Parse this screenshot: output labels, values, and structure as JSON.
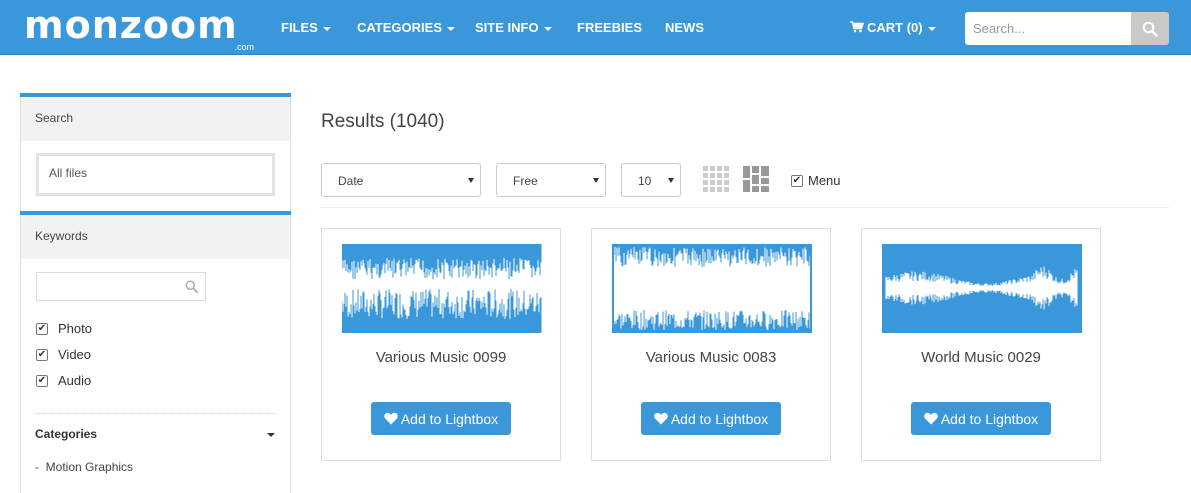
{
  "nav": {
    "logo_text": "monzoom",
    "logo_sub": ".com",
    "items": [
      {
        "label": "FILES",
        "dropdown": true
      },
      {
        "label": "CATEGORIES",
        "dropdown": true
      },
      {
        "label": "SITE INFO",
        "dropdown": true
      },
      {
        "label": "FREEBIES",
        "dropdown": false
      },
      {
        "label": "NEWS",
        "dropdown": false
      }
    ],
    "cart_label": "CART (0)",
    "search_placeholder": "Search...",
    "accent_color": "#3a97d9"
  },
  "sidebar": {
    "search_heading": "Search",
    "files_value": "All files",
    "keywords_heading": "Keywords",
    "keywords_value": "",
    "media_types": [
      {
        "label": "Photo",
        "checked": true
      },
      {
        "label": "Video",
        "checked": true
      },
      {
        "label": "Audio",
        "checked": true
      }
    ],
    "categories_heading": "Categories",
    "categories": [
      "Motion Graphics"
    ]
  },
  "main": {
    "results_title": "Results (1040)",
    "sort_select": "Date",
    "price_select": "Free",
    "per_page_select": "10",
    "menu_label": "Menu",
    "menu_checked": true,
    "lightbox_label": "Add to Lightbox",
    "cards": [
      {
        "title": "Various Music 0099",
        "wave_style": "dense-bands"
      },
      {
        "title": "Various Music 0083",
        "wave_style": "top-bottom-spikes"
      },
      {
        "title": "World Music 0029",
        "wave_style": "center-band"
      }
    ]
  }
}
